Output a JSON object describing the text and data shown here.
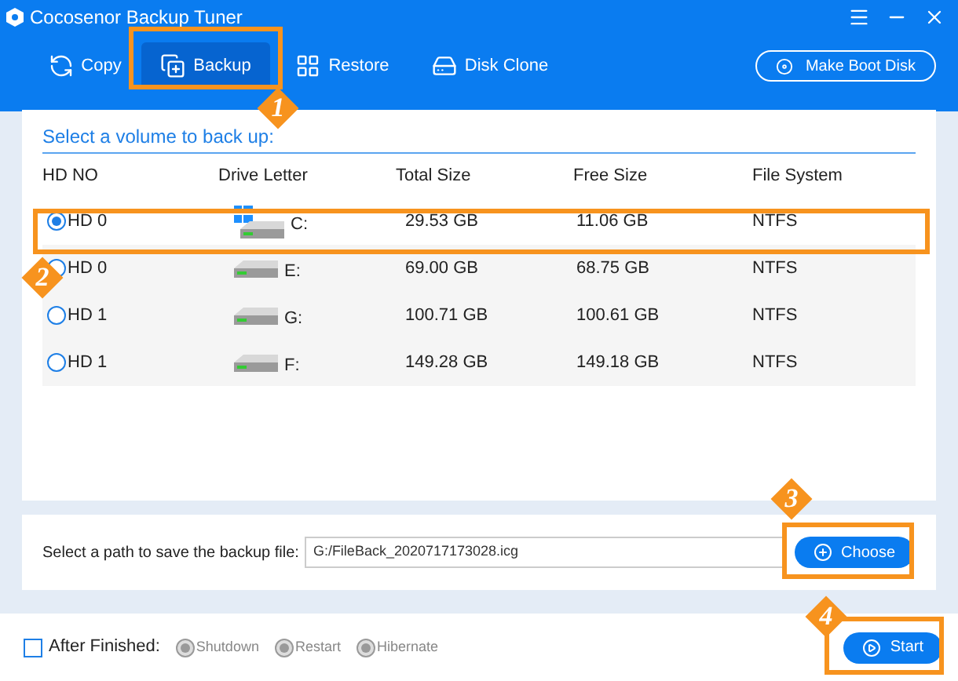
{
  "window": {
    "title": "Cocosenor Backup Tuner"
  },
  "tabs": [
    {
      "label": "Copy",
      "selected": false
    },
    {
      "label": "Backup",
      "selected": true
    },
    {
      "label": "Restore",
      "selected": false
    },
    {
      "label": "Disk Clone",
      "selected": false
    }
  ],
  "boot_button": "Make Boot Disk",
  "volume_panel": {
    "title": "Select a volume to back up:",
    "columns": [
      "HD NO",
      "Drive Letter",
      "Total Size",
      "Free Size",
      "File System"
    ],
    "rows": [
      {
        "hd": "HD 0",
        "drive": "C:",
        "system": true,
        "total": "29.53 GB",
        "free": "11.06 GB",
        "fs": "NTFS",
        "selected": true
      },
      {
        "hd": "HD 0",
        "drive": "E:",
        "system": false,
        "total": "69.00 GB",
        "free": "68.75 GB",
        "fs": "NTFS",
        "selected": false
      },
      {
        "hd": "HD 1",
        "drive": "G:",
        "system": false,
        "total": "100.71 GB",
        "free": "100.61 GB",
        "fs": "NTFS",
        "selected": false
      },
      {
        "hd": "HD 1",
        "drive": "F:",
        "system": false,
        "total": "149.28 GB",
        "free": "149.18 GB",
        "fs": "NTFS",
        "selected": false
      }
    ]
  },
  "path": {
    "label": "Select a path to save the backup file:",
    "value": "G:/FileBack_2020717173028.icg",
    "button": "Choose"
  },
  "footer": {
    "after_label": "After Finished:",
    "checked": false,
    "options": [
      {
        "label": "Shutdown",
        "disabled": true
      },
      {
        "label": "Restart",
        "disabled": true
      },
      {
        "label": "Hibernate",
        "disabled": true
      }
    ],
    "start": "Start"
  },
  "annotations": [
    {
      "number": "1"
    },
    {
      "number": "2"
    },
    {
      "number": "3"
    },
    {
      "number": "4"
    }
  ]
}
